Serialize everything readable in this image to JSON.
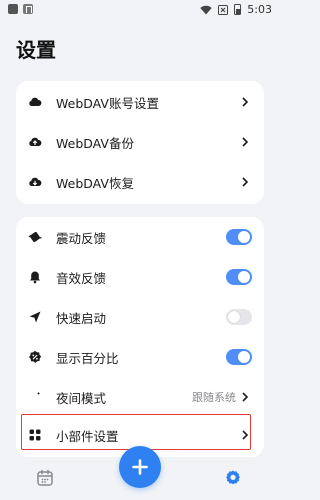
{
  "status_bar": {
    "time": "5:03"
  },
  "page": {
    "title": "设置"
  },
  "webdav_card": {
    "items": [
      {
        "label": "WebDAV账号设置",
        "icon": "cloud-icon"
      },
      {
        "label": "WebDAV备份",
        "icon": "cloud-upload-icon"
      },
      {
        "label": "WebDAV恢复",
        "icon": "cloud-download-icon"
      }
    ]
  },
  "settings_card": {
    "items": [
      {
        "label": "震动反馈",
        "icon": "vibration-icon",
        "toggle": true
      },
      {
        "label": "音效反馈",
        "icon": "bell-icon",
        "toggle": true
      },
      {
        "label": "快速启动",
        "icon": "send-icon",
        "toggle": false
      },
      {
        "label": "显示百分比",
        "icon": "percent-icon",
        "toggle": true
      },
      {
        "label": "夜间模式",
        "icon": "moon-icon",
        "value": "跟随系统"
      },
      {
        "label": "小部件设置",
        "icon": "widgets-icon"
      }
    ]
  },
  "bottom_nav": {
    "left_icon": "calendar-icon",
    "center_icon": "plus-icon",
    "right_icon": "settings-gear-icon"
  },
  "colors": {
    "accent": "#2f80f0",
    "toggle_on": "#4f8ef7",
    "toggle_off": "#e6e6ea",
    "highlight": "#e53935",
    "background": "#f1f3f6"
  }
}
